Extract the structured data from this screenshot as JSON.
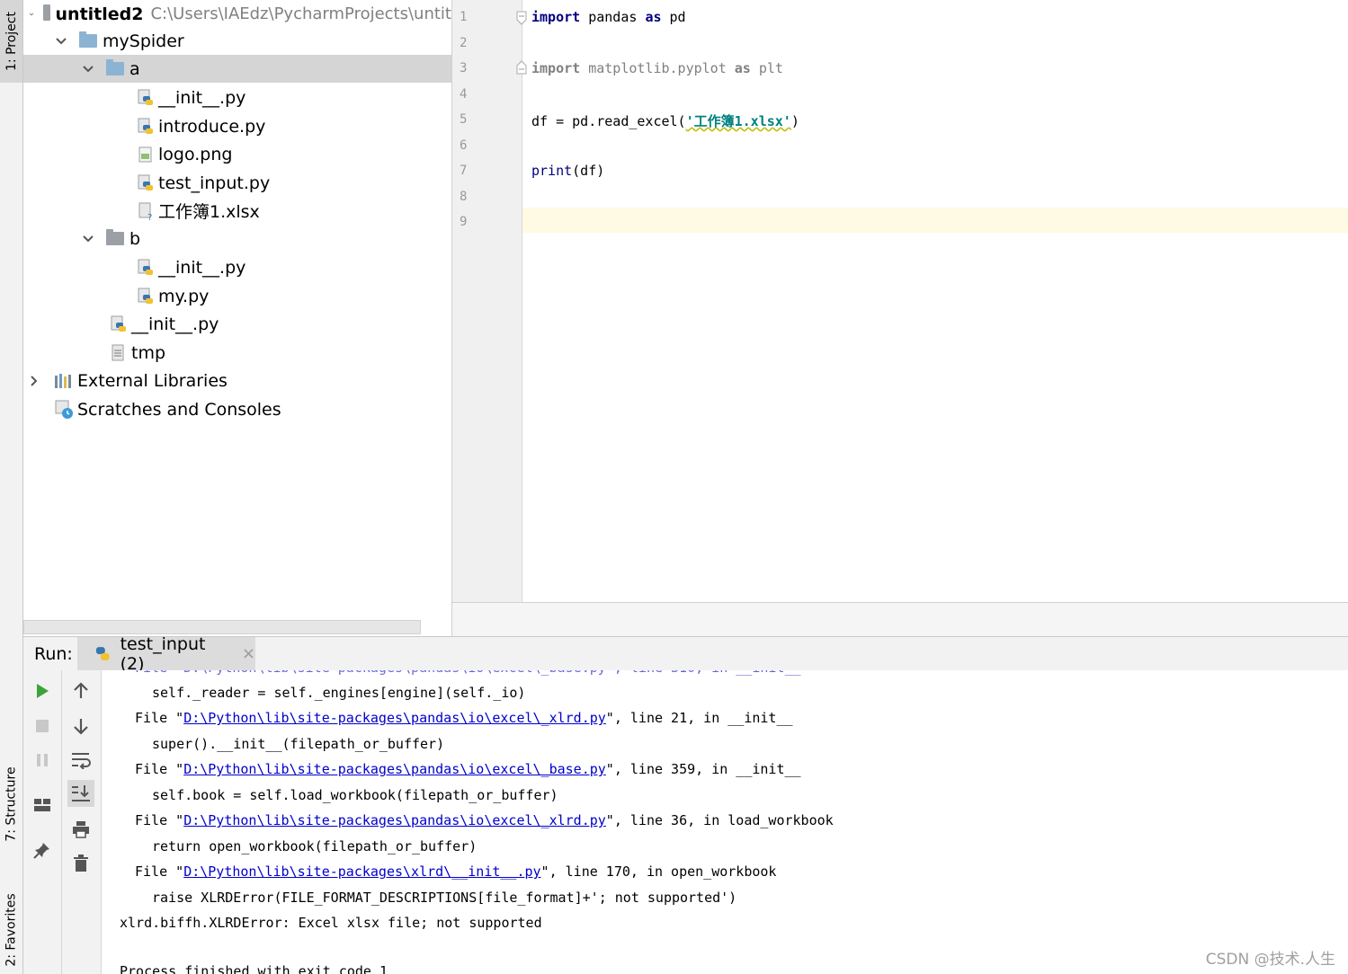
{
  "left_strip": {
    "project_tab": "1: Project",
    "structure_tab": "7: Structure",
    "favorites_tab": "2: Favorites"
  },
  "project_tree": {
    "root_name": "untitled2",
    "root_path": "C:\\Users\\IAEdz\\PycharmProjects\\untit",
    "items": [
      {
        "label": "mySpider"
      },
      {
        "label": "a"
      },
      {
        "label": "__init__.py"
      },
      {
        "label": "introduce.py"
      },
      {
        "label": "logo.png"
      },
      {
        "label": "test_input.py"
      },
      {
        "label": "工作簿1.xlsx"
      },
      {
        "label": "b"
      },
      {
        "label": "__init__.py"
      },
      {
        "label": "my.py"
      },
      {
        "label": "__init__.py"
      },
      {
        "label": "tmp"
      },
      {
        "label": "External Libraries"
      },
      {
        "label": "Scratches and Consoles"
      }
    ]
  },
  "editor": {
    "line_numbers": [
      "1",
      "2",
      "3",
      "4",
      "5",
      "6",
      "7",
      "8",
      "9"
    ],
    "line1": {
      "kw": "import",
      "rest": " pandas ",
      "kw2": "as",
      "rest2": " pd"
    },
    "line3": {
      "kw": "import",
      "rest": " matplotlib.pyplot ",
      "kw2": "as",
      "rest2": " plt"
    },
    "line5": {
      "pre": "df = pd.read_excel(",
      "str": "'工作簿1.xlsx'",
      "post": ")"
    },
    "line7": {
      "fn": "print",
      "rest": "(df)"
    }
  },
  "run": {
    "label": "Run:",
    "tab_label": "test_input (2)",
    "close_glyph": "×"
  },
  "console": {
    "lines": [
      {
        "indent": 2,
        "pre": "self._reader = self._engines[engine](self._io)"
      },
      {
        "indent": 1,
        "pre": "File \"",
        "link": "D:\\Python\\lib\\site-packages\\pandas\\io\\excel\\_xlrd.py",
        "post": "\", line 21, in __init__"
      },
      {
        "indent": 2,
        "pre": "super().__init__(filepath_or_buffer)"
      },
      {
        "indent": 1,
        "pre": "File \"",
        "link": "D:\\Python\\lib\\site-packages\\pandas\\io\\excel\\_base.py",
        "post": "\", line 359, in __init__"
      },
      {
        "indent": 2,
        "pre": "self.book = self.load_workbook(filepath_or_buffer)"
      },
      {
        "indent": 1,
        "pre": "File \"",
        "link": "D:\\Python\\lib\\site-packages\\pandas\\io\\excel\\_xlrd.py",
        "post": "\", line 36, in load_workbook"
      },
      {
        "indent": 2,
        "pre": "return open_workbook(filepath_or_buffer)"
      },
      {
        "indent": 1,
        "pre": "File \"",
        "link": "D:\\Python\\lib\\site-packages\\xlrd\\__init__.py",
        "post": "\", line 170, in open_workbook"
      },
      {
        "indent": 2,
        "pre": "raise XLRDError(FILE_FORMAT_DESCRIPTIONS[file_format]+'; not supported')"
      },
      {
        "indent": 0,
        "pre": "xlrd.biffh.XLRDError: Excel xlsx file; not supported"
      },
      {
        "indent": 0,
        "pre": "Process finished with exit code 1"
      }
    ]
  },
  "watermark": "CSDN @技术.人生",
  "colors": {
    "keyword": "#000080",
    "string": "#008080",
    "link": "#0000cc",
    "current_line": "#fffae3",
    "selection": "#d5d5d5"
  }
}
